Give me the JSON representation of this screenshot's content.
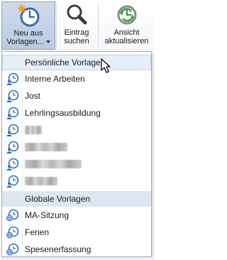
{
  "ribbon": {
    "new_from_template": {
      "line1": "Neu aus",
      "line2": "Vorlagen...",
      "icon": "clock-new-icon"
    },
    "find_entry": {
      "line1": "Eintrag",
      "line2": "suchen",
      "icon": "magnifier-icon"
    },
    "refresh_view": {
      "line1": "Ansicht",
      "line2": "aktualisieren",
      "icon": "clock-refresh-icon"
    }
  },
  "dropdown": {
    "personal_header": "Persönliche Vorlagen",
    "personal_items": [
      {
        "label": "Interne Arbeiten",
        "icon": "person-clock-icon"
      },
      {
        "label": "Jost",
        "icon": "person-clock-icon"
      },
      {
        "label": "Lehrlingsausbildung",
        "icon": "person-clock-icon"
      },
      {
        "label": "",
        "icon": "person-clock-icon",
        "redacted": true
      },
      {
        "label": "",
        "icon": "person-clock-icon",
        "redacted": true
      },
      {
        "label": "",
        "icon": "person-clock-icon",
        "redacted": true
      },
      {
        "label": "",
        "icon": "person-clock-icon",
        "redacted": true
      }
    ],
    "global_header": "Globale Vorlagen",
    "global_items": [
      {
        "label": "MA-Sitzung",
        "icon": "globe-clock-icon"
      },
      {
        "label": "Ferien",
        "icon": "globe-clock-icon"
      },
      {
        "label": "Spesenerfassung",
        "icon": "globe-clock-icon"
      }
    ]
  },
  "colors": {
    "accent_blue": "#2f6fb3",
    "header_bg": "#dde6f1",
    "active_button_bg": "#c6d5e8"
  }
}
